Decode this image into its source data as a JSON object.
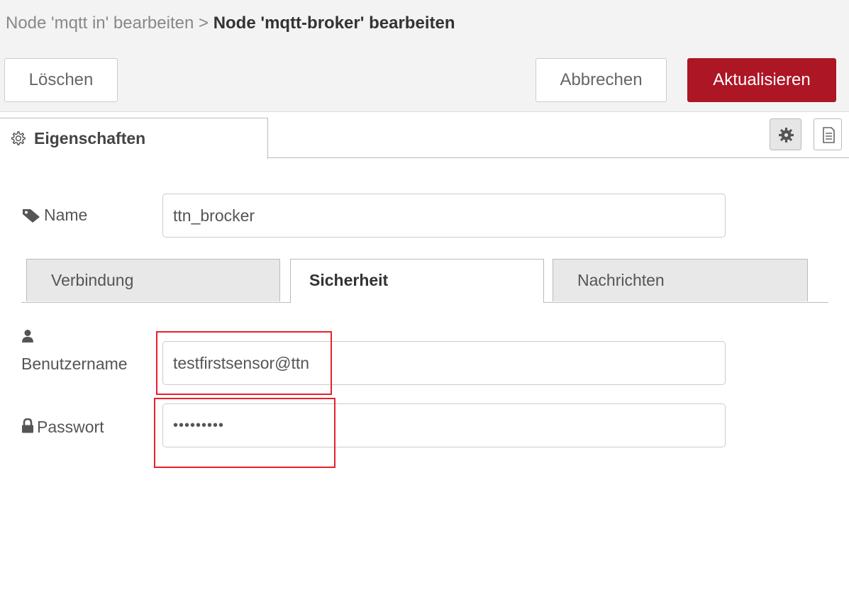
{
  "breadcrumb": {
    "parent": "Node 'mqtt in' bearbeiten",
    "separator": ">",
    "current": "Node 'mqtt-broker' bearbeiten"
  },
  "buttons": {
    "delete": "Löschen",
    "cancel": "Abbrechen",
    "update": "Aktualisieren"
  },
  "colors": {
    "primary": "#ad1625",
    "highlight": "#e8202a",
    "bar_background": "#f3f3f3"
  },
  "tabs": {
    "properties": "Eigenschaften",
    "properties_icon": "gear-icon",
    "tool_icons": [
      "gear-icon",
      "document-icon"
    ]
  },
  "form": {
    "name_label": "Name",
    "name_icon": "tag-icon",
    "name_value": "ttn_brocker",
    "subtabs": [
      "Verbindung",
      "Sicherheit",
      "Nachrichten"
    ],
    "active_subtab": "Sicherheit",
    "username_label": "Benutzername",
    "username_icon": "user-icon",
    "username_value": "testfirstsensor@ttn",
    "password_label": "Passwort",
    "password_icon": "lock-icon",
    "password_value": "•••••••••"
  }
}
